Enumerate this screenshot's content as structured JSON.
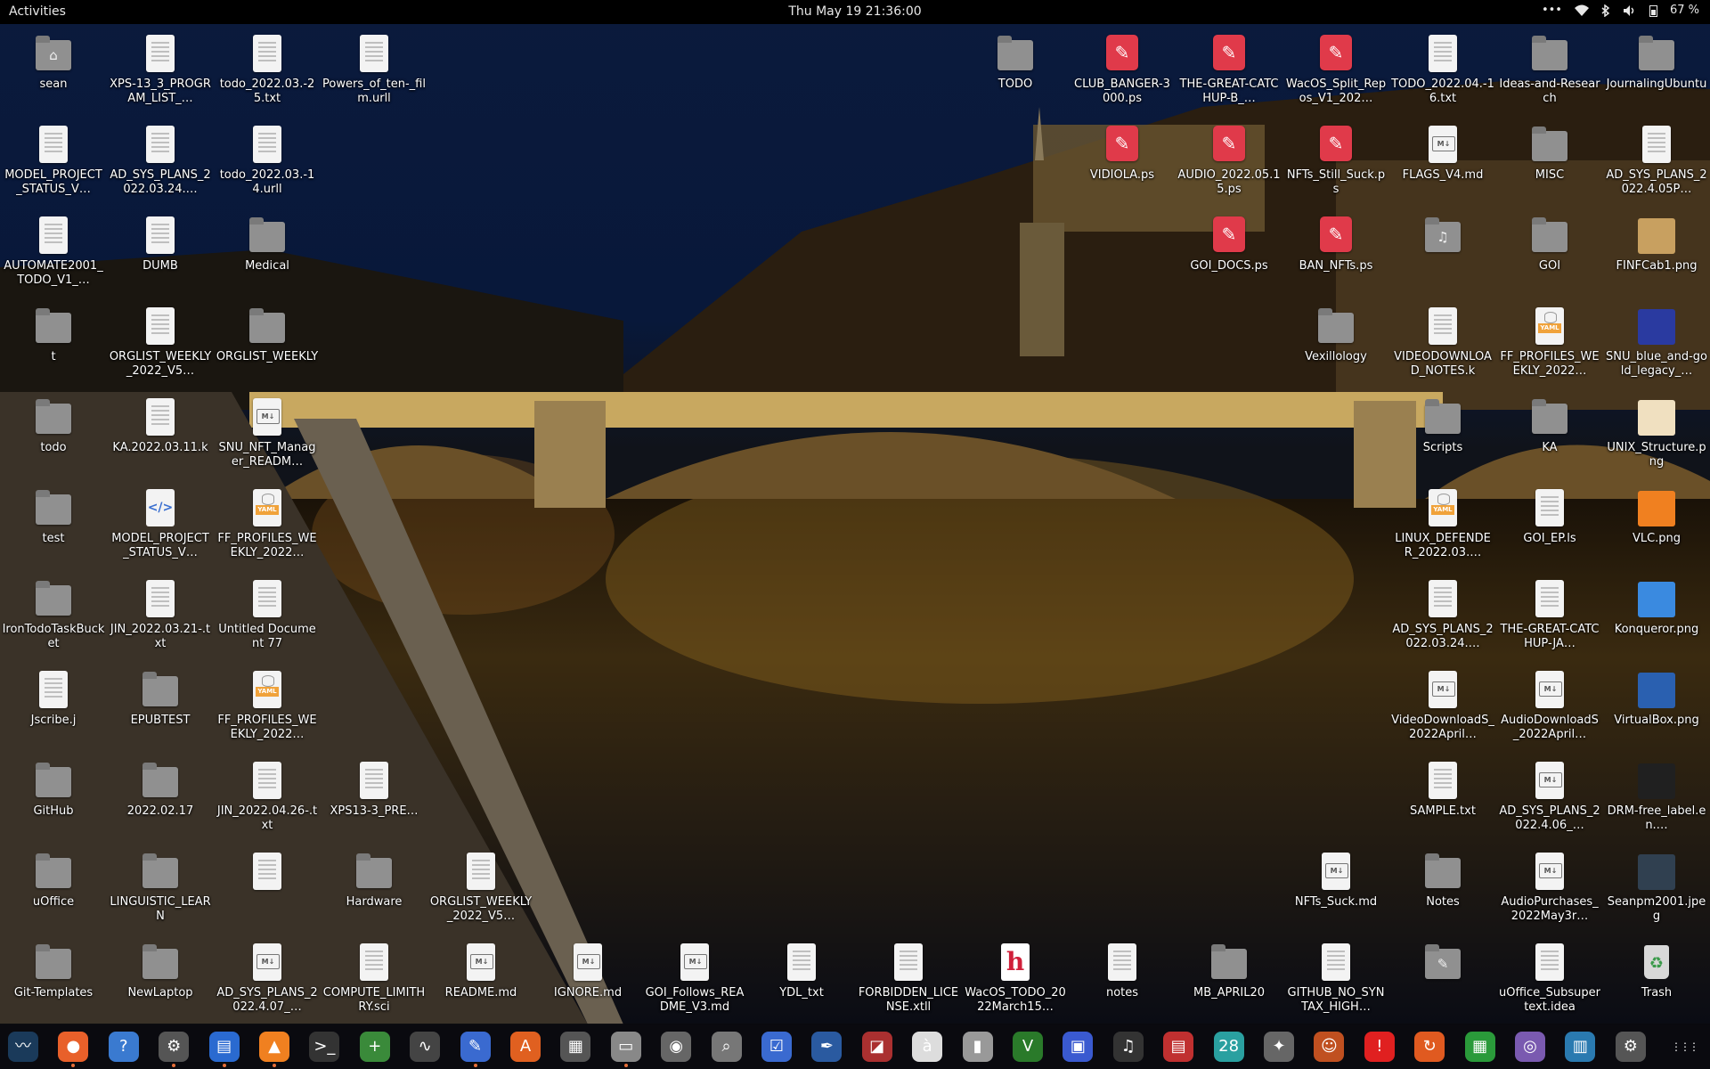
{
  "topbar": {
    "activities": "Activities",
    "clock": "Thu May 19  21:36:00",
    "tray": {
      "overflow": "•••",
      "battery": "67 %"
    }
  },
  "desktop_icons": [
    {
      "label": "sean",
      "type": "folder",
      "emblem": "⌂"
    },
    {
      "label": "XPS-13_3_PROGRAM_LIST_…",
      "type": "doc"
    },
    {
      "label": "todo_2022.03.-25.txt",
      "type": "doc"
    },
    {
      "label": "Powers_of_ten-_film.urll",
      "type": "doc"
    },
    {
      "label": "TODO",
      "type": "folder"
    },
    {
      "label": "CLUB_BANGER-3000.ps",
      "type": "ps"
    },
    {
      "label": "THE-GREAT-CATCHUP-B_…",
      "type": "ps"
    },
    {
      "label": "WacOS_Split_Repos_V1_202…",
      "type": "ps"
    },
    {
      "label": "TODO_2022.04.-16.txt",
      "type": "doc"
    },
    {
      "label": "Ideas-and-Research",
      "type": "folder"
    },
    {
      "label": "JournalingUbuntu",
      "type": "folder"
    },
    {
      "label": "MODEL_PROJECT_STATUS_V…",
      "type": "doc"
    },
    {
      "label": "AD_SYS_PLANS_2022.03.24.…",
      "type": "doc"
    },
    {
      "label": "todo_2022.03.-14.urll",
      "type": "doc"
    },
    {
      "label": "VIDIOLA.ps",
      "type": "ps"
    },
    {
      "label": "AUDIO_2022.05.15.ps",
      "type": "ps"
    },
    {
      "label": "NFTs_Still_Suck.ps",
      "type": "ps"
    },
    {
      "label": "FLAGS_V4.md",
      "type": "md"
    },
    {
      "label": "MISC",
      "type": "folder"
    },
    {
      "label": "AD_SYS_PLANS_2022.4.05P…",
      "type": "doc"
    },
    {
      "label": "AUTOMATE2001_TODO_V1_…",
      "type": "doc"
    },
    {
      "label": "DUMB",
      "type": "doc"
    },
    {
      "label": "Medical",
      "type": "folder"
    },
    {
      "label": "GOI_DOCS.ps",
      "type": "ps"
    },
    {
      "label": "BAN_NFTs.ps",
      "type": "ps"
    },
    {
      "label": "",
      "type": "folder",
      "emblem": "♫"
    },
    {
      "label": "GOI",
      "type": "folder"
    },
    {
      "label": "FINFCab1.png",
      "type": "img",
      "color": "#c8a060"
    },
    {
      "label": "t",
      "type": "folder"
    },
    {
      "label": "ORGLIST_WEEKLY_2022_V5…",
      "type": "doc"
    },
    {
      "label": "ORGLIST_WEEKLY",
      "type": "folder"
    },
    {
      "label": "Vexillology",
      "type": "folder"
    },
    {
      "label": "VIDEODOWNLOAD_NOTES.k",
      "type": "doc"
    },
    {
      "label": "FF_PROFILES_WEEKLY_2022…",
      "type": "yaml"
    },
    {
      "label": "SNU_blue_and-gold_legacy_…",
      "type": "img",
      "color": "#2a3aa0"
    },
    {
      "label": "todo",
      "type": "folder"
    },
    {
      "label": "KA.2022.03.11.k",
      "type": "doc"
    },
    {
      "label": "SNU_NFT_Manager_READM…",
      "type": "md"
    },
    {
      "label": "Scripts",
      "type": "folder"
    },
    {
      "label": "KA",
      "type": "folder"
    },
    {
      "label": "UNIX_Structure.png",
      "type": "img",
      "color": "#f0e0c0"
    },
    {
      "label": "test",
      "type": "folder"
    },
    {
      "label": "MODEL_PROJECT_STATUS_V…",
      "type": "html"
    },
    {
      "label": "FF_PROFILES_WEEKLY_2022…",
      "type": "yaml"
    },
    {
      "label": "LINUX_DEFENDER_2022.03.…",
      "type": "yaml"
    },
    {
      "label": "GOI_EP.ls",
      "type": "doc"
    },
    {
      "label": "VLC.png",
      "type": "img",
      "color": "#f08020"
    },
    {
      "label": "IronTodoTaskBucket",
      "type": "folder"
    },
    {
      "label": "JIN_2022.03.21-.txt",
      "type": "doc"
    },
    {
      "label": "Untitled Document 77",
      "type": "doc"
    },
    {
      "label": "AD_SYS_PLANS_2022.03.24.…",
      "type": "doc"
    },
    {
      "label": "THE-GREAT-CATCHUP-JA…",
      "type": "doc"
    },
    {
      "label": "Konqueror.png",
      "type": "img",
      "color": "#3a8ae0"
    },
    {
      "label": "Jscribe.j",
      "type": "doc"
    },
    {
      "label": "EPUBTEST",
      "type": "folder"
    },
    {
      "label": "FF_PROFILES_WEEKLY_2022…",
      "type": "yaml"
    },
    {
      "label": "VideoDownloadS_2022April…",
      "type": "md"
    },
    {
      "label": "AudioDownloadS_2022April…",
      "type": "md"
    },
    {
      "label": "VirtualBox.png",
      "type": "img",
      "color": "#2a60b0"
    },
    {
      "label": "GitHub",
      "type": "folder"
    },
    {
      "label": "2022.02.17",
      "type": "folder"
    },
    {
      "label": "JIN_2022.04.26-.txt",
      "type": "doc"
    },
    {
      "label": "XPS13-3_PRE…",
      "type": "doc"
    },
    {
      "label": "SAMPLE.txt",
      "type": "doc"
    },
    {
      "label": "AD_SYS_PLANS_2022.4.06_…",
      "type": "md"
    },
    {
      "label": "DRM-free_label.en.…",
      "type": "img",
      "color": "#202020"
    },
    {
      "label": "uOffice",
      "type": "folder"
    },
    {
      "label": "LINGUISTIC_LEARN",
      "type": "folder"
    },
    {
      "label": "",
      "type": "doc"
    },
    {
      "label": "Hardware",
      "type": "folder"
    },
    {
      "label": "ORGLIST_WEEKLY_2022_V5…",
      "type": "doc"
    },
    {
      "label": "NFTs_Suck.md",
      "type": "md"
    },
    {
      "label": "Notes",
      "type": "folder"
    },
    {
      "label": "AudioPurchases_2022May3r…",
      "type": "md"
    },
    {
      "label": "Seanpm2001.jpeg",
      "type": "img",
      "color": "#304050"
    },
    {
      "label": "Git-Templates",
      "type": "folder"
    },
    {
      "label": "NewLaptop",
      "type": "folder"
    },
    {
      "label": "AD_SYS_PLANS_2022.4.07_…",
      "type": "md"
    },
    {
      "label": "COMPUTE_LIMITHRY.sci",
      "type": "doc"
    },
    {
      "label": "README.md",
      "type": "md"
    },
    {
      "label": "IGNORE.md",
      "type": "md"
    },
    {
      "label": "GOI_Follows_README_V3.md",
      "type": "md"
    },
    {
      "label": "YDL_txt",
      "type": "doc"
    },
    {
      "label": "FORBIDDEN_LICENSE.xtll",
      "type": "doc"
    },
    {
      "label": "WacOS_TODO_2022March15…",
      "type": "h"
    },
    {
      "label": "notes",
      "type": "doc"
    },
    {
      "label": "MB_APRIL20",
      "type": "folder"
    },
    {
      "label": "GITHUB_NO_SYNTAX_HIGH…",
      "type": "doc"
    },
    {
      "label": "",
      "type": "folder",
      "emblem": "✎"
    },
    {
      "label": "uOffice_Subsupertext.idea",
      "type": "doc"
    },
    {
      "label": "Trash",
      "type": "trash"
    }
  ],
  "dock": [
    {
      "name": "system-monitor",
      "glyph": "〰",
      "color": "#1a3a5a"
    },
    {
      "name": "firefox",
      "glyph": "●",
      "color": "#e8602a"
    },
    {
      "name": "help",
      "glyph": "?",
      "color": "#3a7ad0"
    },
    {
      "name": "settings",
      "glyph": "⚙",
      "color": "#555"
    },
    {
      "name": "libreoffice-writer",
      "glyph": "▤",
      "color": "#2a6ad0"
    },
    {
      "name": "vlc",
      "glyph": "▲",
      "color": "#f08020"
    },
    {
      "name": "terminal",
      "glyph": ">_",
      "color": "#333"
    },
    {
      "name": "calculator-plus",
      "glyph": "+",
      "color": "#3a8a3a"
    },
    {
      "name": "graph-app",
      "glyph": "∿",
      "color": "#444"
    },
    {
      "name": "text-editor",
      "glyph": "✎",
      "color": "#3a6ad0"
    },
    {
      "name": "software-center",
      "glyph": "A",
      "color": "#e06020"
    },
    {
      "name": "calculator",
      "glyph": "▦",
      "color": "#555"
    },
    {
      "name": "files",
      "glyph": "▭",
      "color": "#888"
    },
    {
      "name": "disc-app",
      "glyph": "◉",
      "color": "#666"
    },
    {
      "name": "image-viewer",
      "glyph": "⌕",
      "color": "#777"
    },
    {
      "name": "tasks",
      "glyph": "☑",
      "color": "#3a6ad0"
    },
    {
      "name": "inkscape",
      "glyph": "✒",
      "color": "#2a5aa0"
    },
    {
      "name": "screenshot",
      "glyph": "◪",
      "color": "#aa3030"
    },
    {
      "name": "character-map",
      "glyph": "à",
      "color": "#ddd"
    },
    {
      "name": "archive-manager",
      "glyph": "▮",
      "color": "#999"
    },
    {
      "name": "vim",
      "glyph": "V",
      "color": "#2a7a2a"
    },
    {
      "name": "remote-desktop",
      "glyph": "▣",
      "color": "#3a5ad0"
    },
    {
      "name": "music",
      "glyph": "♫",
      "color": "#333"
    },
    {
      "name": "pdf-viewer",
      "glyph": "▤",
      "color": "#c03030"
    },
    {
      "name": "calendar",
      "glyph": "28",
      "color": "#2aa0a0"
    },
    {
      "name": "gimp",
      "glyph": "✦",
      "color": "#666"
    },
    {
      "name": "mario-game",
      "glyph": "☺",
      "color": "#c05020"
    },
    {
      "name": "alert-app",
      "glyph": "!",
      "color": "#e02020"
    },
    {
      "name": "ubuntu-updater",
      "glyph": "↻",
      "color": "#e05a20"
    },
    {
      "name": "spreadsheet",
      "glyph": "▦",
      "color": "#2a9a3a"
    },
    {
      "name": "camera-app",
      "glyph": "◎",
      "color": "#7a5ab0"
    },
    {
      "name": "charts-app",
      "glyph": "▥",
      "color": "#2a7ab0"
    },
    {
      "name": "system-tool",
      "glyph": "⚙",
      "color": "#555"
    },
    {
      "name": "show-applications",
      "glyph": "⋮⋮⋮",
      "color": "transparent"
    }
  ]
}
